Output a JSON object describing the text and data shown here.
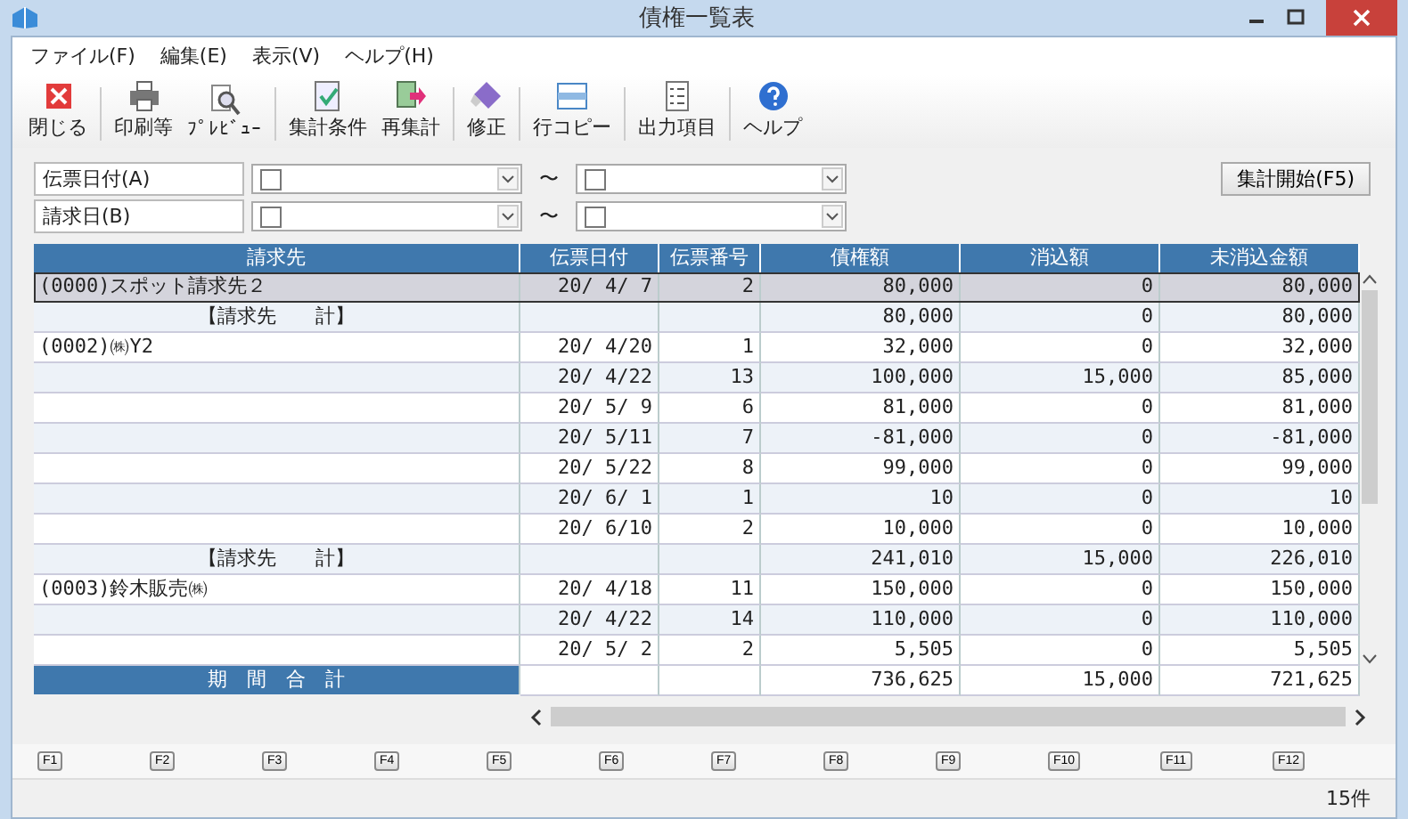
{
  "window": {
    "title": "債権一覧表"
  },
  "menu": [
    "ファイル(F)",
    "編集(E)",
    "表示(V)",
    "ヘルプ(H)"
  ],
  "toolbar": [
    {
      "kind": "close",
      "label": "閉じる"
    },
    {
      "kind": "print",
      "label": "印刷等"
    },
    {
      "kind": "preview",
      "label": "ﾌﾟﾚﾋﾞｭｰ"
    },
    {
      "kind": "conditions",
      "label": "集計条件"
    },
    {
      "kind": "recalc",
      "label": "再集計"
    },
    {
      "kind": "edit",
      "label": "修正"
    },
    {
      "kind": "copy",
      "label": "行コピー"
    },
    {
      "kind": "columns",
      "label": "出力項目"
    },
    {
      "kind": "help",
      "label": "ヘルプ"
    }
  ],
  "filters": [
    {
      "label": "伝票日付(A)",
      "from_checked": false,
      "to_checked": false,
      "separator": "〜"
    },
    {
      "label": "請求日(B)",
      "from_checked": false,
      "to_checked": false,
      "separator": "〜"
    }
  ],
  "start_button": "集計開始(F5)",
  "table": {
    "columns": [
      "請求先",
      "伝票日付",
      "伝票番号",
      "債権額",
      "消込額",
      "未消込金額"
    ],
    "rows": [
      {
        "kind": "detail",
        "selected": true,
        "customer": "(0000)スポット請求先２",
        "date": "20/ 4/ 7",
        "number": "2",
        "amount": "80,000",
        "cleared": "0",
        "remaining": "80,000"
      },
      {
        "kind": "subtotal",
        "selected": false,
        "customer": "【請求先　　計】",
        "amount": "80,000",
        "cleared": "0",
        "remaining": "80,000"
      },
      {
        "kind": "detail",
        "selected": false,
        "customer": "(0002)㈱Y2",
        "date": "20/ 4/20",
        "number": "1",
        "amount": "32,000",
        "cleared": "0",
        "remaining": "32,000"
      },
      {
        "kind": "detail",
        "selected": false,
        "date": "20/ 4/22",
        "number": "13",
        "amount": "100,000",
        "cleared": "15,000",
        "remaining": "85,000"
      },
      {
        "kind": "detail",
        "selected": false,
        "date": "20/ 5/ 9",
        "number": "6",
        "amount": "81,000",
        "cleared": "0",
        "remaining": "81,000"
      },
      {
        "kind": "detail",
        "selected": false,
        "date": "20/ 5/11",
        "number": "7",
        "amount": "-81,000",
        "cleared": "0",
        "remaining": "-81,000"
      },
      {
        "kind": "detail",
        "selected": false,
        "date": "20/ 5/22",
        "number": "8",
        "amount": "99,000",
        "cleared": "0",
        "remaining": "99,000"
      },
      {
        "kind": "detail",
        "selected": false,
        "date": "20/ 6/ 1",
        "number": "1",
        "amount": "10",
        "cleared": "0",
        "remaining": "10"
      },
      {
        "kind": "detail",
        "selected": false,
        "date": "20/ 6/10",
        "number": "2",
        "amount": "10,000",
        "cleared": "0",
        "remaining": "10,000"
      },
      {
        "kind": "subtotal",
        "selected": false,
        "customer": "【請求先　　計】",
        "amount": "241,010",
        "cleared": "15,000",
        "remaining": "226,010"
      },
      {
        "kind": "detail",
        "selected": false,
        "customer": "(0003)鈴木販売㈱",
        "date": "20/ 4/18",
        "number": "11",
        "amount": "150,000",
        "cleared": "0",
        "remaining": "150,000"
      },
      {
        "kind": "detail",
        "selected": false,
        "date": "20/ 4/22",
        "number": "14",
        "amount": "110,000",
        "cleared": "0",
        "remaining": "110,000"
      },
      {
        "kind": "detail",
        "selected": false,
        "date": "20/ 5/ 2",
        "number": "2",
        "amount": "5,505",
        "cleared": "0",
        "remaining": "5,505"
      }
    ],
    "total": {
      "label": "期　間　合　計",
      "amount": "736,625",
      "cleared": "15,000",
      "remaining": "721,625"
    }
  },
  "function_keys": [
    "F1",
    "F2",
    "F3",
    "F4",
    "F5",
    "F6",
    "F7",
    "F8",
    "F9",
    "F10",
    "F11",
    "F12"
  ],
  "status_bar": {
    "count": "15件"
  }
}
